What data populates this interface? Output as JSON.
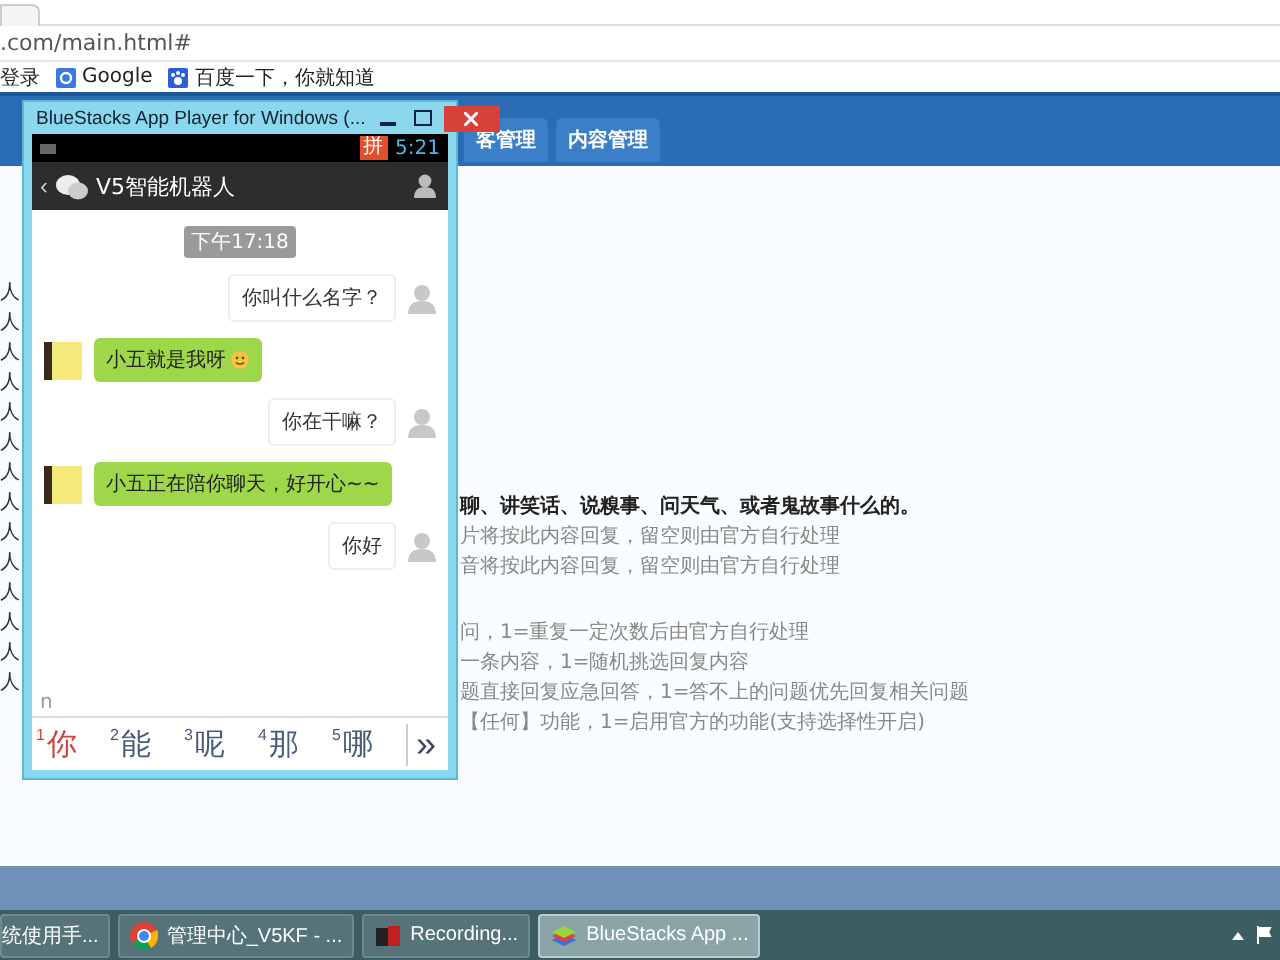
{
  "browser": {
    "address": ".com/main.html#",
    "bookmarks": [
      {
        "label": "登录",
        "kind": "text"
      },
      {
        "label": "Google",
        "kind": "google"
      },
      {
        "label": "百度一下，你就知道",
        "kind": "baidu"
      }
    ],
    "nav_tabs": [
      "客管理",
      "内容管理"
    ],
    "left_column": [
      "人",
      "人",
      "人",
      "人",
      "人",
      "人",
      "人",
      "人",
      "人",
      "人",
      "人",
      "人",
      "人",
      "人"
    ],
    "help_lines": [
      {
        "text": "聊、讲笑话、说糗事、问天气、或者鬼故事什么的。",
        "kind": "bold"
      },
      {
        "text": "片将按此内容回复，留空则由官方自行处理",
        "kind": "plain"
      },
      {
        "text": "音将按此内容回复，留空则由官方自行处理",
        "kind": "plain"
      },
      {
        "text": "问，1=重复一定次数后由官方自行处理",
        "kind": "gap"
      },
      {
        "text": "一条内容，1=随机挑选回复内容",
        "kind": "plain"
      },
      {
        "text": "题直接回复应急回答，1=答不上的问题优先回复相关问题",
        "kind": "plain"
      },
      {
        "text": "【任何】功能，1=启用官方的功能(支持选择性开启)",
        "kind": "plain"
      }
    ]
  },
  "emulator": {
    "back": "‹",
    "title": "BlueStacks App Player for Windows (...",
    "time": "5:21",
    "ime_badge": "拼",
    "chat_title": "V5智能机器人",
    "timestamp": "下午17:18",
    "messages": [
      {
        "kind": "sent",
        "text": "你叫什么名字？",
        "emoji": false
      },
      {
        "kind": "received",
        "text": "小五就是我呀",
        "emoji": true
      },
      {
        "kind": "sent",
        "text": "你在干嘛？",
        "emoji": false
      },
      {
        "kind": "received",
        "text": "小五正在陪你聊天，好开心~~",
        "emoji": false
      },
      {
        "kind": "sent",
        "text": "你好",
        "emoji": false
      }
    ],
    "input": "n",
    "candidates": [
      {
        "number": "1",
        "char": "你",
        "selected": true
      },
      {
        "number": "2",
        "char": "能",
        "selected": false
      },
      {
        "number": "3",
        "char": "呢",
        "selected": false
      },
      {
        "number": "4",
        "char": "那",
        "selected": false
      },
      {
        "number": "5",
        "char": "哪",
        "selected": false
      }
    ],
    "more": "»"
  },
  "taskbar": [
    {
      "label": "统使用手...",
      "kind": "doc",
      "selected": false
    },
    {
      "label": "管理中心_V5KF - ...",
      "kind": "chrome",
      "selected": false
    },
    {
      "label": "Recording...",
      "kind": "recorder",
      "selected": false
    },
    {
      "label": "BlueStacks App ...",
      "kind": "bluestacks",
      "selected": true
    }
  ]
}
